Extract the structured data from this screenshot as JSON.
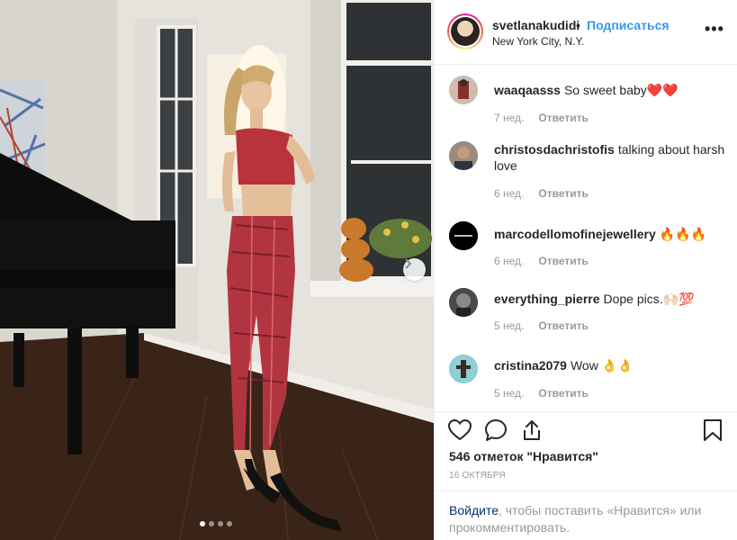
{
  "post": {
    "author": "svetlanakudidi",
    "separator": "•",
    "follow_label": "Подписаться",
    "location": "New York City, N.Y.",
    "more_label": "•••"
  },
  "comments": [
    {
      "user": "waaqaasss",
      "text": "So sweet baby❤️❤️",
      "age": "7 нед.",
      "reply_label": "Ответить"
    },
    {
      "user": "christosdachristofis",
      "text": "talking about harsh love",
      "age": "6 нед.",
      "reply_label": "Ответить"
    },
    {
      "user": "marcodellomofinejewellery",
      "text": "🔥🔥🔥",
      "age": "6 нед.",
      "reply_label": "Ответить"
    },
    {
      "user": "everything_pierre",
      "text": "Dope pics.🙌🏻💯",
      "age": "5 нед.",
      "reply_label": "Ответить"
    },
    {
      "user": "cristina2079",
      "text": "Wow 👌👌",
      "age": "5 нед.",
      "reply_label": "Ответить"
    }
  ],
  "actions": {
    "like_icon": "heart-outline-icon",
    "comment_icon": "comment-icon",
    "share_icon": "share-icon",
    "save_icon": "bookmark-icon"
  },
  "likes_text": "546 отметок \"Нравится\"",
  "date_text": "16 октября",
  "login": {
    "link_text": "Войдите",
    "rest_text": ", чтобы поставить «Нравится» или прокомментировать."
  },
  "carousel": {
    "slide_count": 4,
    "active_index": 0
  },
  "colors": {
    "accent": "#3897f0",
    "muted": "#999999",
    "link_dark": "#003569",
    "text": "#262626"
  }
}
